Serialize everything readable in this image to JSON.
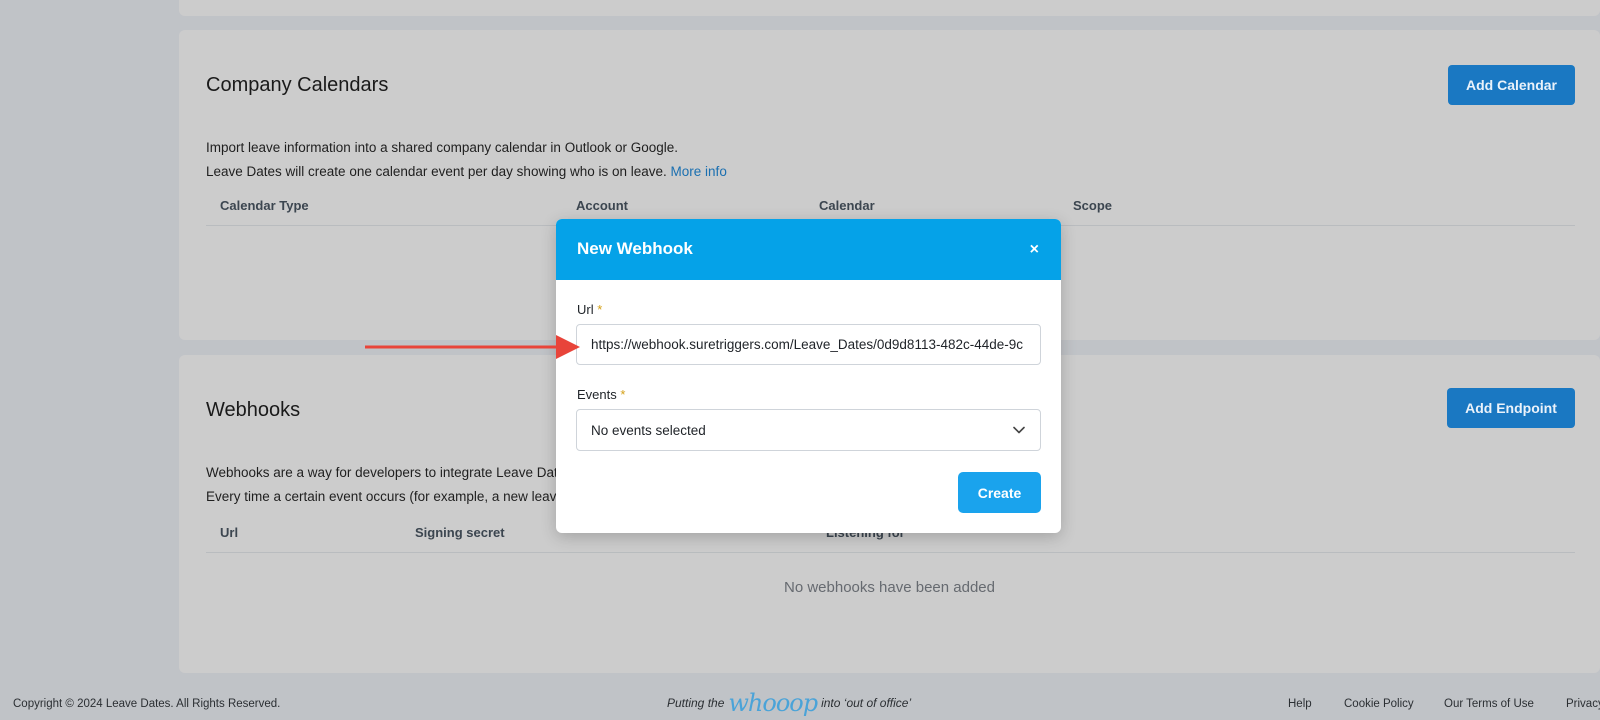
{
  "calendars_section": {
    "title": "Company Calendars",
    "add_button": "Add Calendar",
    "desc_line1": "Import leave information into a shared company calendar in Outlook or Google.",
    "desc_line2": "Leave Dates will create one calendar event per day showing who is on leave.",
    "more_info": "More info",
    "columns": [
      "Calendar Type",
      "Account",
      "Calendar",
      "Scope"
    ]
  },
  "webhooks_section": {
    "title": "Webhooks",
    "add_button": "Add Endpoint",
    "desc_line1": "Webhooks are a way for developers to integrate Leave Dat",
    "desc_line2": "Every time a certain event occurs (for example, a new leave",
    "columns": [
      "Url",
      "Signing secret",
      "Listening for"
    ],
    "empty_message": "No webhooks have been added"
  },
  "modal": {
    "title": "New Webhook",
    "close": "×",
    "url_label": "Url",
    "url_required": "*",
    "url_value": "https://webhook.suretriggers.com/Leave_Dates/0d9d8113-482c-44de-9c",
    "events_label": "Events",
    "events_required": "*",
    "events_value": "No events selected",
    "create_button": "Create"
  },
  "footer": {
    "copyright": "Copyright © 2024 Leave Dates. All Rights Reserved.",
    "tagline_pre": "Putting the",
    "tagline_logo": "whooop",
    "tagline_post": "into ‘out of office’",
    "links": [
      "Help",
      "Cookie Policy",
      "Our Terms of Use",
      "Privacy"
    ]
  },
  "colors": {
    "modal_header": "#05a2e8",
    "primary_button": "#1aa3ed",
    "annotation_arrow": "#e8443a"
  }
}
